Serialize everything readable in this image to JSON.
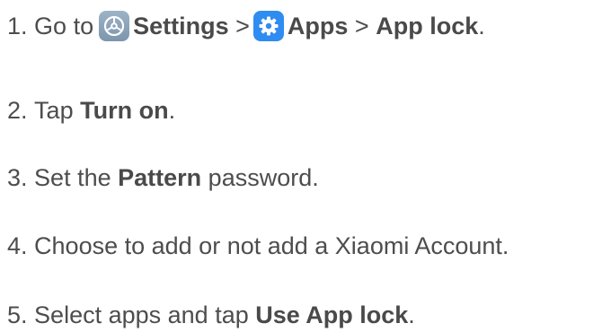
{
  "steps": [
    {
      "number": "1.",
      "parts": {
        "prefix": "Go to",
        "settings": "Settings",
        "sep1": ">",
        "apps": "Apps",
        "sep2": ">",
        "applock": "App lock",
        "end": "."
      },
      "icons": [
        "settings-icon",
        "apps-gear-icon"
      ]
    },
    {
      "number": "2.",
      "parts": {
        "prefix": "Tap",
        "bold": "Turn on",
        "end": "."
      }
    },
    {
      "number": "3.",
      "parts": {
        "prefix": "Set the",
        "bold": "Pattern",
        "suffix": "password."
      }
    },
    {
      "number": "4.",
      "parts": {
        "text": "Choose to add or not add a Xiaomi Account."
      }
    },
    {
      "number": "5.",
      "parts": {
        "prefix": "Select apps and tap",
        "bold": "Use App lock",
        "end": "."
      }
    }
  ],
  "colors": {
    "text": "#4d4d4d",
    "settings_icon_bg": "#8aa3ba",
    "apps_icon_bg": "#2f8cf0"
  }
}
